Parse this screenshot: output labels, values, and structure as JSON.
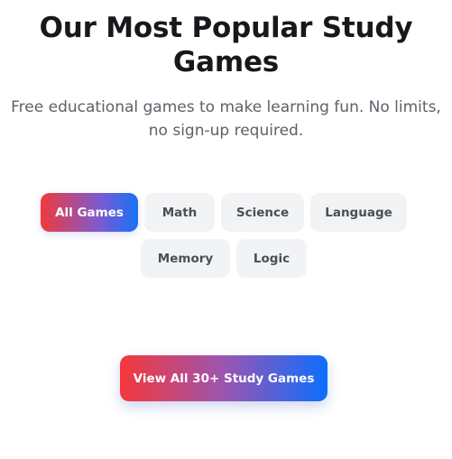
{
  "header": {
    "title": "Our Most Popular Study Games",
    "subtitle": "Free educational games to make learning fun. No limits, no sign-up required."
  },
  "filters": {
    "active": "All Games",
    "items": [
      {
        "label": "All Games",
        "active": true
      },
      {
        "label": "Math",
        "active": false
      },
      {
        "label": "Science",
        "active": false
      },
      {
        "label": "Language",
        "active": false
      },
      {
        "label": "Memory",
        "active": false
      },
      {
        "label": "Logic",
        "active": false
      }
    ]
  },
  "cta": {
    "label": "View All 30+ Study Games"
  },
  "colors": {
    "gradient_start": "#f03a3a",
    "gradient_end": "#1672f5",
    "chip_background": "#f2f3f5",
    "title_text": "#16181b",
    "subtitle_text": "#5d6168"
  }
}
